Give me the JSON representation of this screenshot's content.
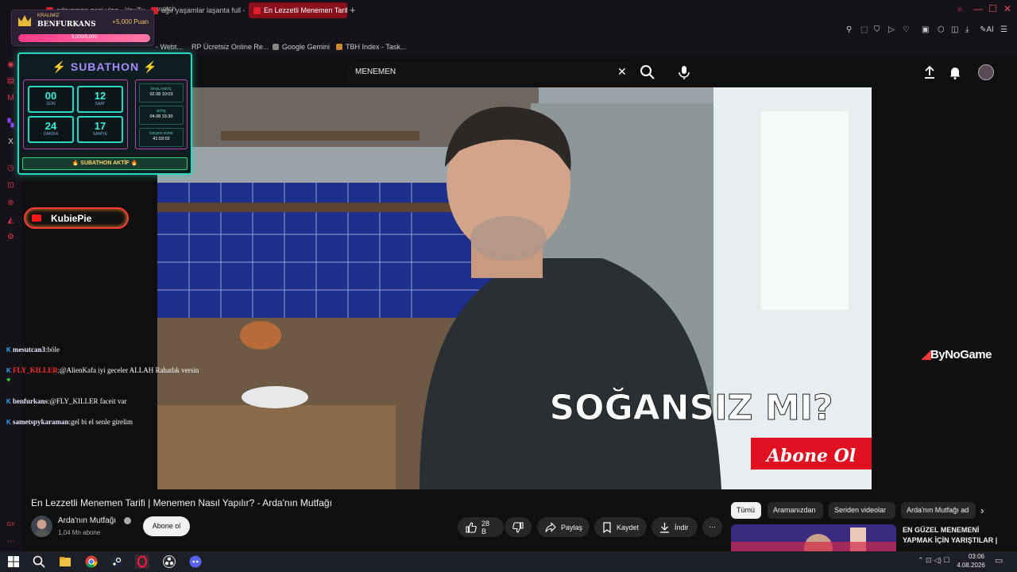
{
  "browser": {
    "tabs": [
      {
        "label": "adryaman.gazi.ylog - YouTube"
      },
      {
        "label": "ağır yaşamlar laşanta full -"
      },
      {
        "label": "En Lezzetli Menemen Tarifi"
      }
    ],
    "address_fragment": "watch",
    "bookmarks": [
      {
        "label": "- Webt..."
      },
      {
        "label": "RP Ücretsiz Online Re..."
      },
      {
        "label": "Google Gemini"
      },
      {
        "label": "TBH Index - Task..."
      }
    ]
  },
  "overlay": {
    "kral": {
      "label": "KRALIMIZ",
      "name": "BENFURKANS",
      "points": "+5,000 Puan",
      "progress_text": "5,000/5,000",
      "progress_fraction": 1.0
    },
    "subathon": {
      "title": "⚡ SUBATHON ⚡",
      "timer": [
        {
          "value": "00",
          "label": "GÜN"
        },
        {
          "value": "12",
          "label": "SAAT"
        },
        {
          "value": "24",
          "label": "DAKİKA"
        },
        {
          "value": "17",
          "label": "SANİYE"
        }
      ],
      "info": [
        {
          "label": "BAŞLANGIÇ",
          "value": "02.08 10:03"
        },
        {
          "label": "BİTİŞ",
          "value": "04.08 15:30"
        },
        {
          "label": "GEÇEN SÜRE",
          "value": "41:03:02"
        }
      ],
      "status": "🔥 SUBATHON AKTİF 🔥"
    },
    "channel_badge": "KubiePie"
  },
  "chat": [
    {
      "user": "mesutcan3",
      "message": "böle",
      "red": false
    },
    {
      "user": "FLY_KILLER",
      "message": "@AlienKafa iyi geceler ALLAH Rahatlık versin",
      "red": true
    },
    {
      "user": "benfurkans",
      "message": "@FLY_KILLER faceit var",
      "red": false
    },
    {
      "user": "sametspykaraman",
      "message": "gel bi el senle girelim",
      "red": false
    }
  ],
  "youtube": {
    "search_value": "MENEMEN",
    "video": {
      "caption": "SOĞANSIZ MI?",
      "subscribe_overlay": "Abone Ol",
      "watermark": "ByNoGame"
    },
    "title": "En Lezzetli Menemen Tarifi | Menemen Nasıl Yapılır? - Arda'nın Mutfağı",
    "channel": {
      "name": "Arda'nın Mutfağı",
      "subscribers": "1,04 Mn abone",
      "subscribe_label": "Abone ol"
    },
    "actions": {
      "likes": "28 B",
      "share": "Paylaş",
      "save": "Kaydet",
      "download": "İndir"
    },
    "chips": [
      {
        "label": "Tümü",
        "selected": true
      },
      {
        "label": "Aramanızdan",
        "selected": false
      },
      {
        "label": "Seriden videolar",
        "selected": false
      },
      {
        "label": "Arda'nın Mutfağı ad",
        "selected": false
      }
    ],
    "recommendation_title": "EN GÜZEL MENEMENİ YAPMAK İÇİN YARIŞTILAR |"
  },
  "taskbar": {
    "time": "03:06",
    "date": "4.08.2026"
  }
}
